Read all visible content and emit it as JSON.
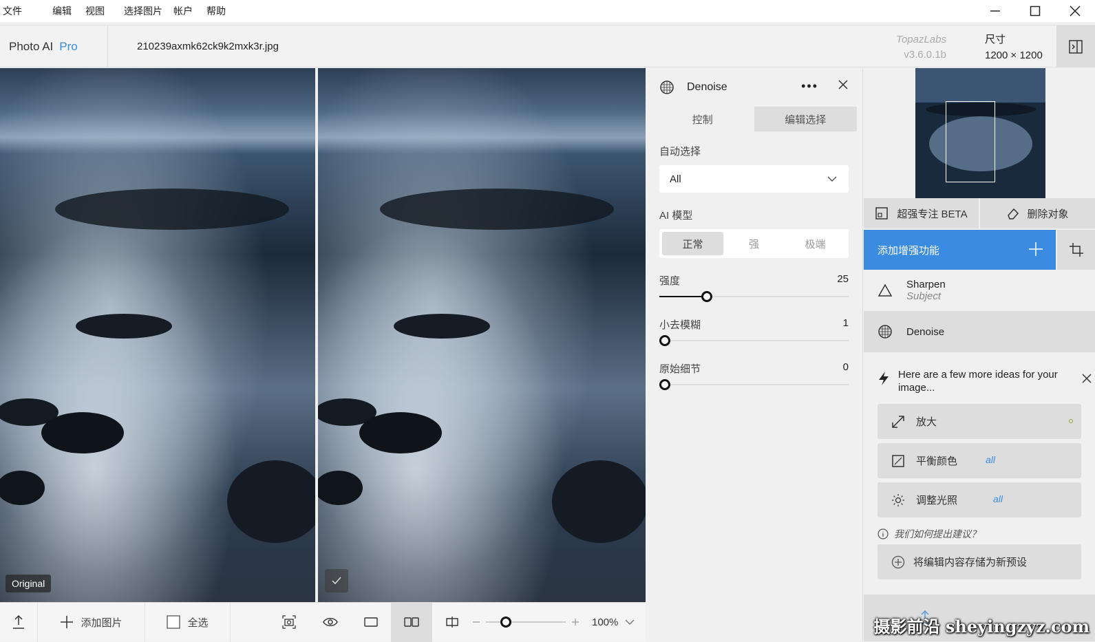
{
  "menu": {
    "items": [
      "文件",
      "编辑",
      "视图",
      "选择图片",
      "帐户",
      "帮助"
    ]
  },
  "header": {
    "app_name": "Photo AI",
    "app_tier": "Pro",
    "filename": "210239axmk62ck9k2mxk3r.jpg",
    "vendor": "TopazLabs",
    "version": "v3.6.0.1b",
    "dims_label": "尺寸",
    "dims_value": "1200 × 1200"
  },
  "preview": {
    "original_label": "Original"
  },
  "settings": {
    "title": "Denoise",
    "tab_control": "控制",
    "tab_edit_selection": "编辑选择",
    "auto_select_label": "自动选择",
    "auto_select_value": "All",
    "ai_model_label": "AI 模型",
    "models": [
      "正常",
      "强",
      "极端"
    ],
    "selected_model": "正常",
    "sliders": [
      {
        "label": "强度",
        "value": "25",
        "fraction": 0.25
      },
      {
        "label": "小去模糊",
        "value": "1",
        "fraction": 0.01
      },
      {
        "label": "原始细节",
        "value": "0",
        "fraction": 0.0
      }
    ]
  },
  "right": {
    "feature_tabs": [
      "超强专注 BETA",
      "删除对象"
    ],
    "add_enhancement": "添加增强功能",
    "models": [
      {
        "name": "Sharpen",
        "sub": "Subject"
      },
      {
        "name": "Denoise"
      }
    ],
    "ideas_header": "Here are a few more ideas for your image...",
    "ideas": [
      {
        "label": "放大",
        "tag": ""
      },
      {
        "label": "平衡颜色",
        "tag": "all"
      },
      {
        "label": "调整光照",
        "tag": "all"
      }
    ],
    "how_suggest": "我们如何提出建议？",
    "save_preset": "将编辑内容存储为新预设"
  },
  "toolbar": {
    "add_image": "添加图片",
    "select_all": "全选",
    "zoom": "100%",
    "zoom_fraction": 0.25
  },
  "watermark": "摄影前沿 sheyingzyz.com"
}
